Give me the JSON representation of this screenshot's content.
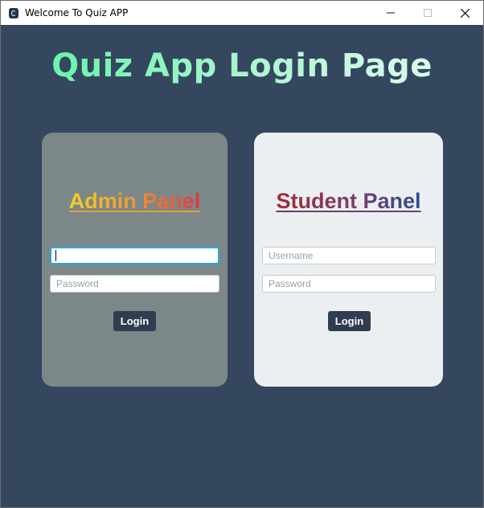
{
  "window": {
    "title": "Welcome To Quiz APP",
    "icon": "app-icon",
    "controls": [
      "minimize-icon",
      "maximize-icon",
      "close-icon"
    ]
  },
  "page": {
    "heading": "Quiz App Login Page"
  },
  "admin": {
    "title": "Admin Panel",
    "username_placeholder": "",
    "password_placeholder": "Password",
    "login_label": "Login"
  },
  "student": {
    "title": "Student Panel",
    "username_placeholder": "Username",
    "password_placeholder": "Password",
    "login_label": "Login"
  },
  "colors": {
    "background": "#34475e",
    "admin_card": "#7b8789",
    "student_card": "#eceff1",
    "button": "#2e3d4f",
    "focus_border": "#2aa6d8"
  }
}
